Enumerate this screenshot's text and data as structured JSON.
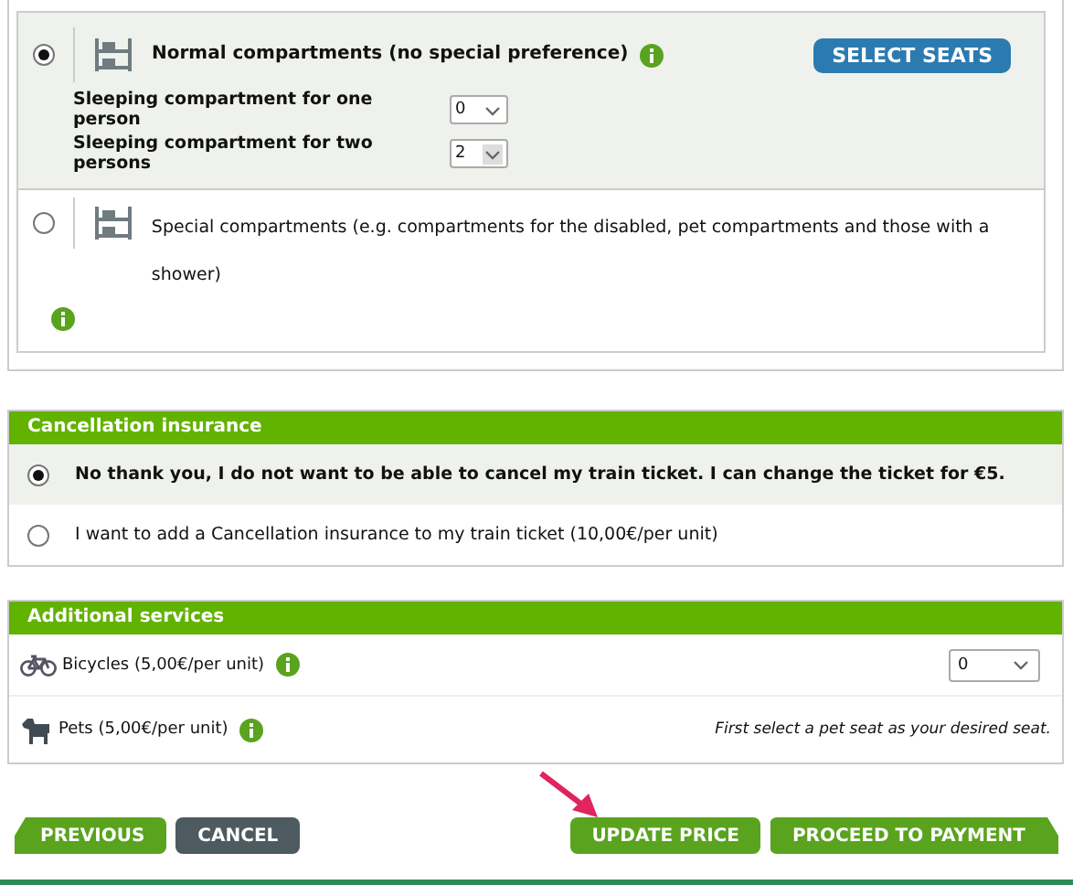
{
  "compartments": [
    {
      "label": "Normal compartments (no special preference)",
      "selected": true,
      "info": true,
      "action": "SELECT SEATS",
      "options": [
        {
          "label": "Sleeping compartment for one person",
          "value": "0",
          "disabled": false
        },
        {
          "label": "Sleeping compartment for two persons",
          "value": "2",
          "disabled": true
        }
      ]
    },
    {
      "label": "Special compartments (e.g. compartments for the disabled, pet compartments and those with a shower)",
      "selected": false,
      "info": true
    }
  ],
  "cancellation": {
    "title": "Cancellation insurance",
    "options": [
      {
        "label": "No thank you, I do not want to be able to cancel my train ticket. I can change the ticket for €5.",
        "selected": true
      },
      {
        "label": "I want to add a Cancellation insurance to my train ticket (10,00€/per unit)",
        "selected": false
      }
    ]
  },
  "services": {
    "title": "Additional services",
    "items": [
      {
        "kind": "bicycle",
        "label": "Bicycles (5,00€/per unit)",
        "value": "0"
      },
      {
        "kind": "pet",
        "label": "Pets (5,00€/per unit)",
        "note": "First select a pet seat as your desired seat."
      }
    ]
  },
  "buttons": [
    {
      "label": "PREVIOUS",
      "kind": "back"
    },
    {
      "label": "CANCEL",
      "kind": "secondary"
    },
    {
      "label": "UPDATE PRICE",
      "kind": "primary"
    },
    {
      "label": "PROCEED TO PAYMENT",
      "kind": "forward"
    }
  ]
}
